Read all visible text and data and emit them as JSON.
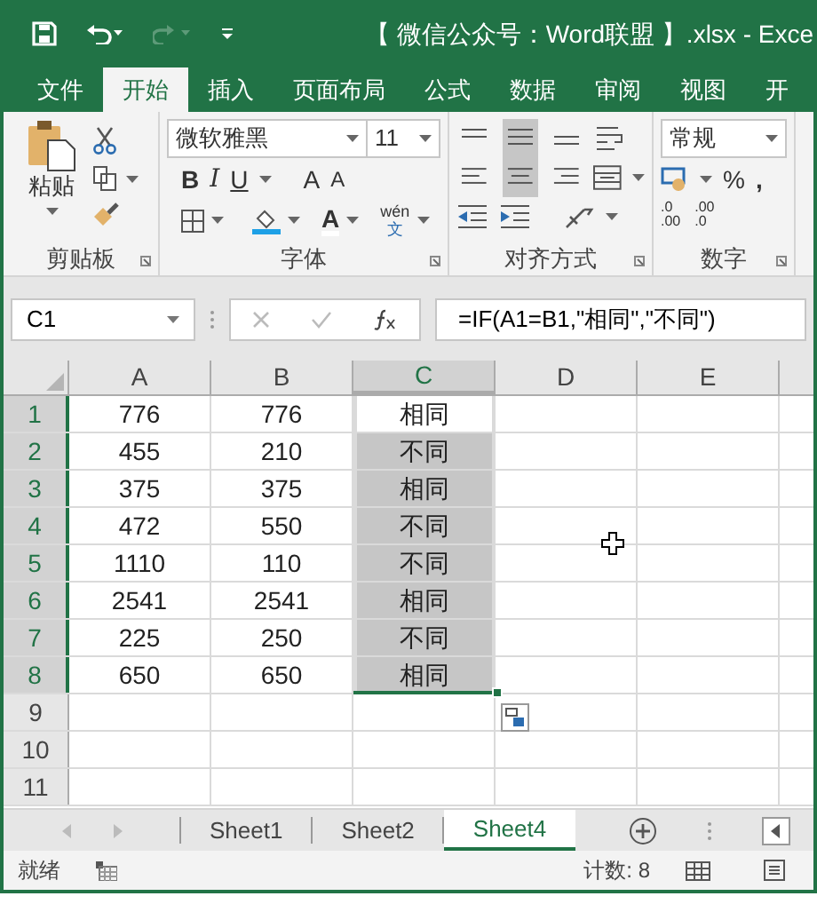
{
  "window": {
    "title": "【 微信公众号：Word联盟 】.xlsx - Exce"
  },
  "ribbon_tabs": [
    {
      "label": "文件",
      "selected": false
    },
    {
      "label": "开始",
      "selected": true
    },
    {
      "label": "插入",
      "selected": false
    },
    {
      "label": "页面布局",
      "selected": false
    },
    {
      "label": "公式",
      "selected": false
    },
    {
      "label": "数据",
      "selected": false
    },
    {
      "label": "审阅",
      "selected": false
    },
    {
      "label": "视图",
      "selected": false
    },
    {
      "label": "开",
      "selected": false
    }
  ],
  "clipboard": {
    "paste": "粘贴",
    "label": "剪贴板"
  },
  "font": {
    "name": "微软雅黑",
    "size": "11",
    "bold": "B",
    "italic": "I",
    "underline": "U",
    "grow": "A",
    "shrink": "A",
    "font_color_letter": "A",
    "phonetic_top": "wén",
    "phonetic_bottom": "文",
    "label": "字体"
  },
  "alignment": {
    "label": "对齐方式"
  },
  "number": {
    "format": "常规",
    "percent": "%",
    "comma": ",",
    "inc_top": ".0",
    "inc_bottom": ".00",
    "dec_top": ".00",
    "dec_bottom": ".0",
    "label": "数字"
  },
  "name_box": "C1",
  "formula": "=IF(A1=B1,\"相同\",\"不同\")",
  "columns": [
    {
      "label": "A",
      "selected": false
    },
    {
      "label": "B",
      "selected": false
    },
    {
      "label": "C",
      "selected": true
    },
    {
      "label": "D",
      "selected": false
    },
    {
      "label": "E",
      "selected": false
    }
  ],
  "rows": [
    {
      "header": "1",
      "selected": true,
      "a": "776",
      "b": "776",
      "c": "相同",
      "c_active": true
    },
    {
      "header": "2",
      "selected": true,
      "a": "455",
      "b": "210",
      "c": "不同",
      "c_active": false
    },
    {
      "header": "3",
      "selected": true,
      "a": "375",
      "b": "375",
      "c": "相同",
      "c_active": false
    },
    {
      "header": "4",
      "selected": true,
      "a": "472",
      "b": "550",
      "c": "不同",
      "c_active": false
    },
    {
      "header": "5",
      "selected": true,
      "a": "1110",
      "b": "110",
      "c": "不同",
      "c_active": false
    },
    {
      "header": "6",
      "selected": true,
      "a": "2541",
      "b": "2541",
      "c": "相同",
      "c_active": false
    },
    {
      "header": "7",
      "selected": true,
      "a": "225",
      "b": "250",
      "c": "不同",
      "c_active": false
    },
    {
      "header": "8",
      "selected": true,
      "a": "650",
      "b": "650",
      "c": "相同",
      "c_active": false
    },
    {
      "header": "9",
      "selected": false
    },
    {
      "header": "10",
      "selected": false
    },
    {
      "header": "11",
      "selected": false
    }
  ],
  "sheets": [
    {
      "label": "Sheet1",
      "selected": false
    },
    {
      "label": "Sheet2",
      "selected": false
    },
    {
      "label": "Sheet4",
      "selected": true
    }
  ],
  "status_bar": {
    "ready": "就绪",
    "count": "计数: 8"
  }
}
